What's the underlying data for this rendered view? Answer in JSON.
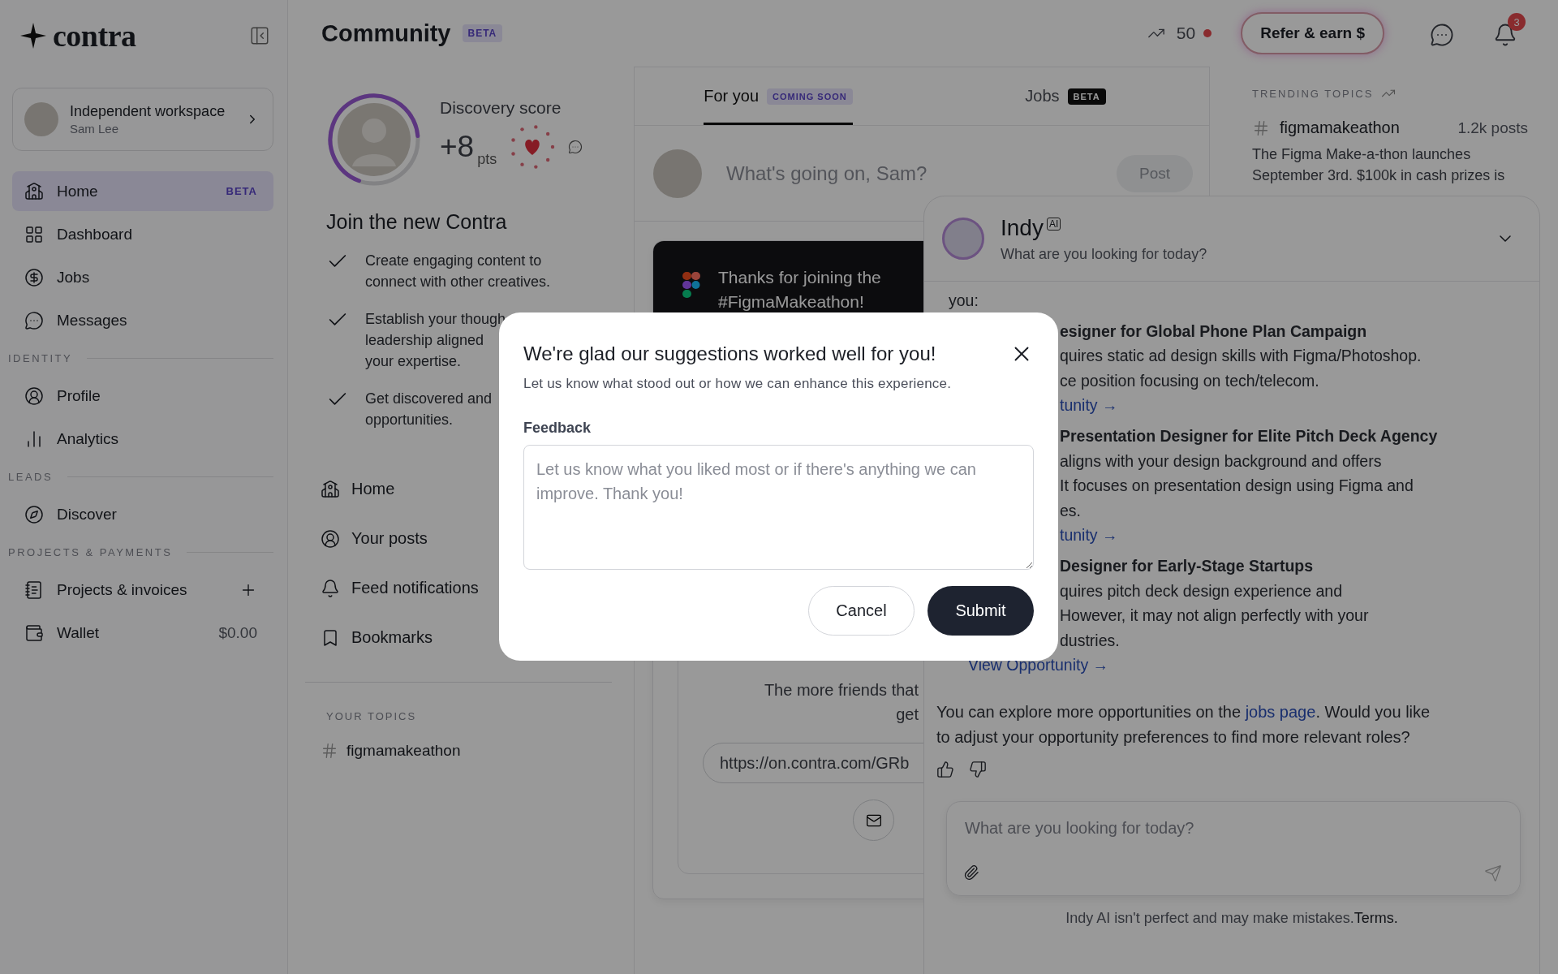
{
  "sidebar": {
    "logo": "contra",
    "workspace": {
      "title": "Independent workspace",
      "subtitle": "Sam Lee"
    },
    "top_items": [
      {
        "label": "Home",
        "selected": true,
        "kind": "badge",
        "badge": "BETA"
      },
      {
        "label": "Dashboard",
        "selected": false,
        "kind": "plain"
      },
      {
        "label": "Jobs",
        "selected": false,
        "kind": "plain"
      },
      {
        "label": "Messages",
        "selected": false,
        "kind": "plain"
      }
    ],
    "sections": [
      {
        "title": "IDENTITY",
        "items": [
          {
            "label": "Profile",
            "selected": false,
            "kind": "plain"
          },
          {
            "label": "Analytics",
            "selected": false,
            "kind": "plain"
          }
        ]
      },
      {
        "title": "LEADS",
        "items": [
          {
            "label": "Discover",
            "selected": false,
            "kind": "plain"
          }
        ]
      },
      {
        "title": "PROJECTS & PAYMENTS",
        "items": [
          {
            "label": "Projects & invoices",
            "selected": false,
            "kind": "add"
          },
          {
            "label": "Wallet",
            "selected": false,
            "kind": "amount",
            "value": "$0.00"
          }
        ]
      }
    ]
  },
  "header": {
    "title": "Community",
    "badge": "BETA",
    "streak": "50",
    "refer_button": "Refer & earn $",
    "notification_count": "3"
  },
  "profile": {
    "level": 0.68,
    "score_label": "Discovery score",
    "score": "+8",
    "unit": "pts",
    "title": "Join the new Contra",
    "tasks": [
      {
        "checked": true,
        "lines": [
          "Create engaging content to",
          "connect with other creatives."
        ]
      },
      {
        "checked": true,
        "lines": [
          "Establish your though",
          "leadership aligned",
          "your expertise."
        ]
      },
      {
        "checked": true,
        "lines": [
          "Get discovered and",
          "opportunities."
        ]
      }
    ]
  },
  "community_nav": [
    "Home",
    "Your posts",
    "Feed notifications",
    "Bookmarks"
  ],
  "topics": {
    "title": "YOUR TOPICS",
    "items": [
      "figmamakeathon"
    ]
  },
  "feed": {
    "tabs": [
      {
        "label": "For you",
        "badge": "COMING SOON",
        "kind": "light",
        "selected": true
      },
      {
        "label": "Jobs",
        "badge": "BETA",
        "kind": "dark",
        "selected": false
      }
    ],
    "composer": {
      "placeholder": "What's going on, Sam?",
      "button": "Post",
      "disabled": true
    },
    "promo": {
      "title": "Thanks for joining the #FigmaMakeathon!",
      "lines": [
        "The more friends that",
        "get"
      ],
      "link": "https://on.contra.com/GRb"
    }
  },
  "trending": {
    "title": "TRENDING TOPICS",
    "items": [
      {
        "tag": "figmamakeathon",
        "count": "1.2k posts",
        "description": "The Figma Make-a-thon launches September 3rd. $100k in cash prizes is"
      }
    ]
  },
  "indy": {
    "name": "Indy",
    "badge": "AI",
    "subtitle": "What are you looking for today?",
    "intro": "you:",
    "lines": [
      {
        "kind": "heading",
        "text": "esigner for Global Phone Plan Campaign"
      },
      {
        "kind": "text",
        "text": "quires static ad design skills with Figma/Photoshop."
      },
      {
        "kind": "text",
        "text": "ce position focusing on tech/telecom."
      },
      {
        "kind": "link",
        "text": "tunity →"
      },
      {
        "kind": "heading",
        "text": "Presentation Designer for Elite Pitch Deck Agency"
      },
      {
        "kind": "text",
        "text": "aligns with your design background and offers"
      },
      {
        "kind": "text",
        "text": "It focuses on presentation design using Figma and"
      },
      {
        "kind": "text",
        "text": "es."
      },
      {
        "kind": "link",
        "text": "tunity →"
      },
      {
        "kind": "heading",
        "text": "Designer for Early-Stage Startups"
      },
      {
        "kind": "text",
        "text": "quires pitch deck design experience and"
      },
      {
        "kind": "text",
        "text": "However, it may not align perfectly with your"
      },
      {
        "kind": "text",
        "text": "dustries."
      }
    ],
    "final_link": "View Opportunity →",
    "reply": {
      "before": "You can explore more opportunities on the ",
      "link": "jobs page",
      "after": ". Would you like to adjust your opportunity preferences to find more relevant roles?"
    },
    "input_placeholder": "What are you looking for today?",
    "disclaimer": "Indy AI isn't perfect and may make mistakes.",
    "terms": "Terms."
  },
  "modal": {
    "title": "We're glad our suggestions worked well for you!",
    "subtitle": "Let us know what stood out or how we can enhance this experience.",
    "field_label": "Feedback",
    "placeholder": "Let us know what you liked most or if there's anything we can improve. Thank you!",
    "cancel": "Cancel",
    "submit": "Submit"
  }
}
